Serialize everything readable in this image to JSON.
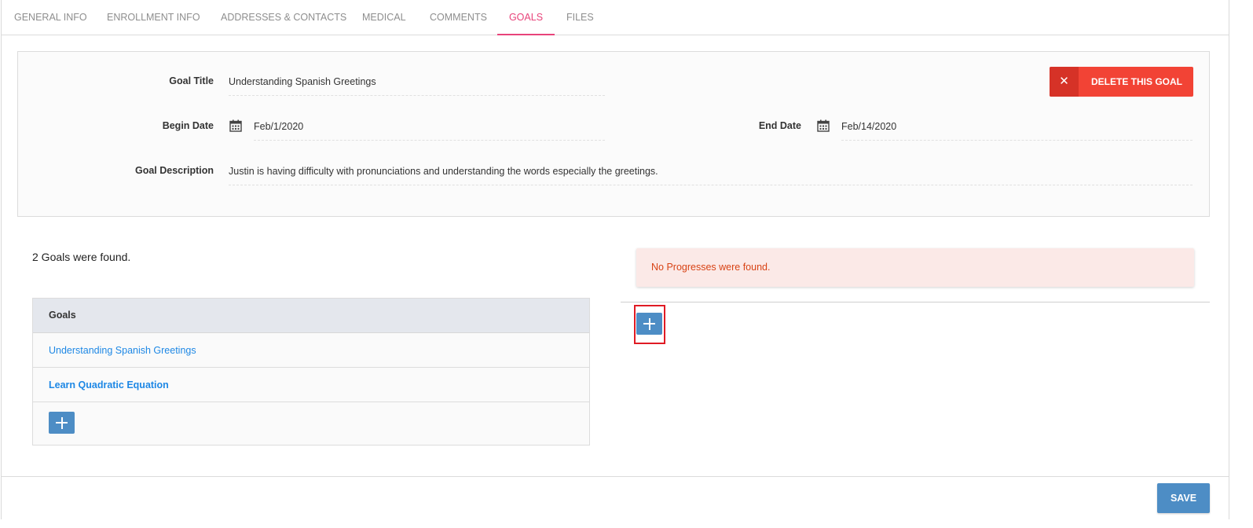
{
  "tabs": [
    {
      "label": "GENERAL INFO"
    },
    {
      "label": "ENROLLMENT INFO"
    },
    {
      "label": "ADDRESSES & CONTACTS"
    },
    {
      "label": "MEDICAL"
    },
    {
      "label": "COMMENTS"
    },
    {
      "label": "GOALS",
      "active": true
    },
    {
      "label": "FILES"
    }
  ],
  "goal_form": {
    "title_label": "Goal Title",
    "title_value": "Understanding Spanish Greetings",
    "begin_label": "Begin Date",
    "begin_value": "Feb/1/2020",
    "end_label": "End Date",
    "end_value": "Feb/14/2020",
    "description_label": "Goal Description",
    "description_value": "Justin is having difficulty with pronunciations and understanding the words especially the greetings.",
    "delete_label": "DELETE THIS GOAL",
    "delete_icon": "close-icon"
  },
  "goals_list": {
    "found_text": "2 Goals were found.",
    "header": "Goals",
    "items": [
      {
        "label": "Understanding Spanish Greetings"
      },
      {
        "label": "Learn Quadratic Equation"
      }
    ]
  },
  "progress": {
    "empty_text": "No Progresses were found."
  },
  "footer": {
    "save_label": "SAVE"
  },
  "colors": {
    "accent": "#e8437a",
    "danger": "#f24335",
    "primary": "#4d8dc5",
    "link": "#1e88e5"
  }
}
